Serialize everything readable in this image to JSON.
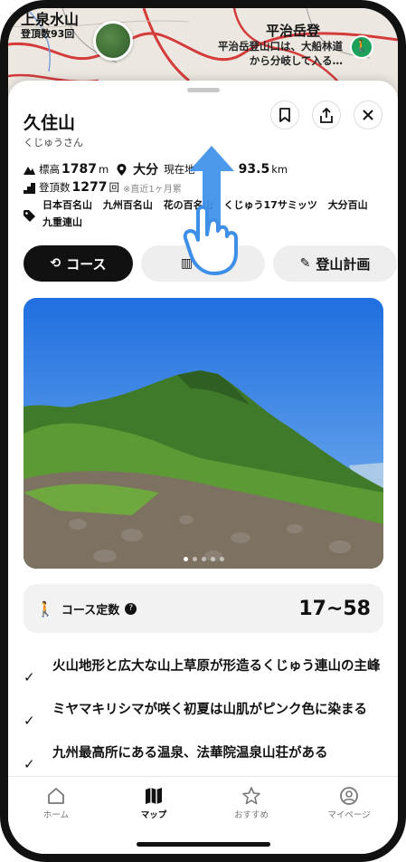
{
  "status": {
    "map_label": "上泉水山",
    "map_sub": "登頂数93回",
    "right_label": "平治岳登"
  },
  "map": {
    "tooltip": "平治岳登山口は、大船林道から分岐して入る…"
  },
  "mountain": {
    "name": "久住山",
    "kana": "くじゅうさん",
    "elevation_label": "標高",
    "elevation_value": "1787",
    "elevation_unit": "m",
    "prefecture": "大分",
    "distance_label": "現在地",
    "distance_value": "93.5",
    "distance_unit": "km",
    "climbs_label": "登頂数",
    "climbs_value": "1277",
    "climbs_unit": "回",
    "climbs_note": "※直近1ヶ月累",
    "tags": [
      "日本百名山",
      "九州百名山",
      "花の百名山",
      "くじゅう17サミッツ",
      "大分百山",
      "九重連山"
    ]
  },
  "tabs": [
    {
      "label": "コース",
      "icon": "route-icon"
    },
    {
      "label": "地図",
      "icon": "map-icon"
    },
    {
      "label": "登山計画",
      "icon": "edit-icon"
    }
  ],
  "photo": {
    "dots": 5,
    "active_dot": 0
  },
  "course_number": {
    "label": "コース定数",
    "value": "17~58"
  },
  "features": [
    "火山地形と広大な山上草原が形造るくじゅう連山の主峰",
    "ミヤマキリシマが咲く初夏は山肌がピンク色に染まる",
    "九州最高所にある温泉、法華院温泉山荘がある"
  ],
  "nav": [
    {
      "label": "ホーム",
      "icon": "home-icon"
    },
    {
      "label": "マップ",
      "icon": "map-icon"
    },
    {
      "label": "おすすめ",
      "icon": "star-icon"
    },
    {
      "label": "マイページ",
      "icon": "user-icon"
    }
  ],
  "nav_active": 1,
  "colors": {
    "accent": "#111111",
    "gesture": "#3d8fe8",
    "walker": "#1fa05a"
  }
}
